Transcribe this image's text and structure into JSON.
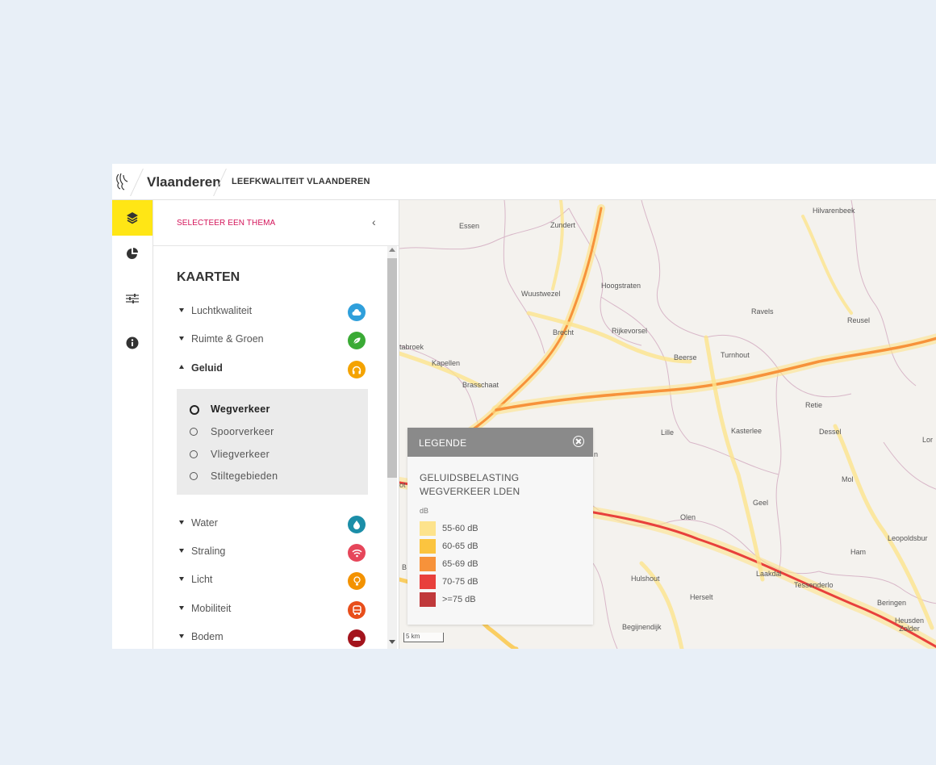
{
  "header": {
    "brand": "Vlaanderen",
    "breadcrumb": "LEEFKWALITEIT VLAANDEREN"
  },
  "sidebar_icons": [
    {
      "name": "layers-icon",
      "active": true
    },
    {
      "name": "pie-chart-icon",
      "active": false
    },
    {
      "name": "sliders-icon",
      "active": false
    },
    {
      "name": "info-icon",
      "active": false
    }
  ],
  "panel": {
    "theme_select": "SELECTEER EEN THEMA",
    "section_title": "KAARTEN",
    "categories": [
      {
        "label": "Luchtkwaliteit",
        "icon": "cloud-icon",
        "color": "#2f9fdb",
        "expanded": false
      },
      {
        "label": "Ruimte & Groen",
        "icon": "leaf-icon",
        "color": "#3aaa35",
        "expanded": false
      },
      {
        "label": "Geluid",
        "icon": "headphones-icon",
        "color": "#f4a300",
        "expanded": true
      },
      {
        "label": "Water",
        "icon": "drop-icon",
        "color": "#1b8ea8",
        "expanded": false
      },
      {
        "label": "Straling",
        "icon": "wifi-icon",
        "color": "#e6465a",
        "expanded": false
      },
      {
        "label": "Licht",
        "icon": "bulb-icon",
        "color": "#f39200",
        "expanded": false
      },
      {
        "label": "Mobiliteit",
        "icon": "bus-icon",
        "color": "#e84e1b",
        "expanded": false
      },
      {
        "label": "Bodem",
        "icon": "soil-icon",
        "color": "#a3141d",
        "expanded": false
      }
    ],
    "geluid_options": [
      {
        "label": "Wegverkeer",
        "selected": true
      },
      {
        "label": "Spoorverkeer",
        "selected": false
      },
      {
        "label": "Vliegverkeer",
        "selected": false
      },
      {
        "label": "Stiltegebieden",
        "selected": false
      }
    ]
  },
  "legend": {
    "header": "LEGENDE",
    "title": "GELUIDSBELASTING WEGVERKEER LDEN",
    "unit": "dB",
    "items": [
      {
        "label": "55-60 dB",
        "color": "#fde38c"
      },
      {
        "label": "60-65 dB",
        "color": "#fbc43f"
      },
      {
        "label": "65-69 dB",
        "color": "#f7923a"
      },
      {
        "label": "70-75 dB",
        "color": "#e8403c"
      },
      {
        "label": ">=75 dB",
        "color": "#c0393b"
      }
    ]
  },
  "map": {
    "scale_label": "5 km",
    "places": [
      "Hilvarenbeek",
      "Essen",
      "Zundert",
      "Hoogstraten",
      "Wuustwezel",
      "Ravels",
      "Reusel",
      "Brecht",
      "Rijkevorsel",
      "tabroek",
      "Beerse",
      "Turnhout",
      "Kapellen",
      "Brasschaat",
      "Retie",
      "Lille",
      "Kasterlee",
      "Dessel",
      "Lor",
      "Mol",
      "Geel",
      "Olen",
      "Leopoldsbur",
      "Ham",
      "Hulshout",
      "Laakdal",
      "Tessenderlo",
      "Herselt",
      "Beringen",
      "Heusden Zolder",
      "Begijnendijk",
      "ot",
      "n",
      "B"
    ]
  }
}
